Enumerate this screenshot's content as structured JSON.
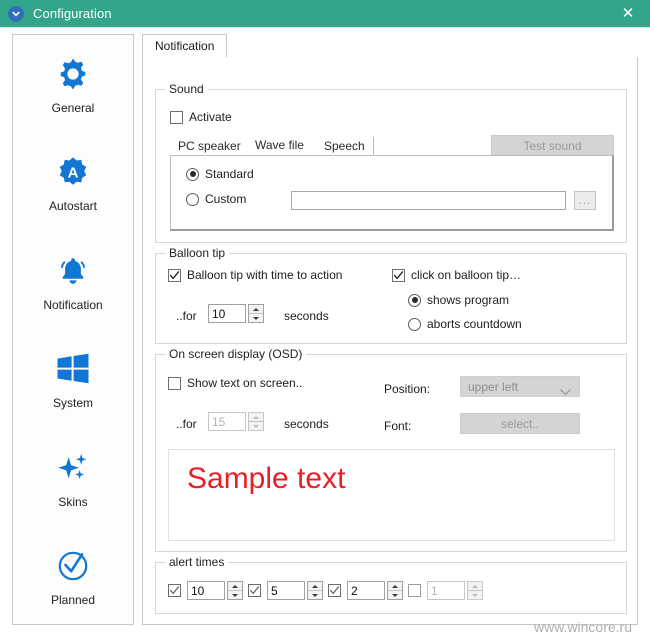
{
  "window": {
    "title": "Configuration",
    "app_icon": "chevron-circle-icon",
    "close_label": "✕",
    "titlebar_color": "#31a68a",
    "accent_color": "#2e6fb7",
    "watermark": "www.wincore.ru"
  },
  "sidebar": {
    "items": [
      {
        "label": "General",
        "icon": "gear-icon"
      },
      {
        "label": "Autostart",
        "icon": "autostart-badge-icon"
      },
      {
        "label": "Notification",
        "icon": "bell-icon"
      },
      {
        "label": "System",
        "icon": "windows-logo-icon"
      },
      {
        "label": "Skins",
        "icon": "sparkles-icon"
      },
      {
        "label": "Planned",
        "icon": "check-circle-icon"
      }
    ]
  },
  "tabs": [
    {
      "label": "Notification",
      "active": true
    }
  ],
  "sound": {
    "legend": "Sound",
    "activate": {
      "label": "Activate",
      "checked": false
    },
    "test_button": {
      "label": "Test sound",
      "enabled": false
    },
    "inner_tabs": [
      {
        "label": "PC speaker",
        "active": false
      },
      {
        "label": "Wave file",
        "active": true
      },
      {
        "label": "Speech",
        "active": false
      }
    ],
    "standard": {
      "label": "Standard",
      "selected": true
    },
    "custom": {
      "label": "Custom",
      "selected": false
    },
    "path_value": "",
    "path_placeholder": "",
    "browse_label": "..."
  },
  "balloon": {
    "legend": "Balloon tip",
    "with_time": {
      "label": "Balloon tip with time to action",
      "checked": true
    },
    "for_label": "..for",
    "seconds_label": "seconds",
    "seconds_value": "10",
    "click_on": {
      "label": "click on balloon tip…",
      "checked": true
    },
    "shows_program": {
      "label": "shows program",
      "selected": true
    },
    "aborts_countdown": {
      "label": "aborts countdown",
      "selected": false
    }
  },
  "osd": {
    "legend": "On screen display (OSD)",
    "show_text": {
      "label": "Show text on screen..",
      "checked": false
    },
    "for_label": "..for",
    "seconds_label": "seconds",
    "seconds_value": "15",
    "position_label": "Position:",
    "position_value": "upper left",
    "font_label": "Font:",
    "font_button": "select..",
    "sample_text": "Sample text",
    "sample_color": "#e81f26"
  },
  "alert_times": {
    "legend": "alert times",
    "items": [
      {
        "checked": true,
        "value": "10",
        "enabled": true
      },
      {
        "checked": true,
        "value": "5",
        "enabled": true
      },
      {
        "checked": true,
        "value": "2",
        "enabled": true
      },
      {
        "checked": false,
        "value": "1",
        "enabled": false
      }
    ]
  }
}
